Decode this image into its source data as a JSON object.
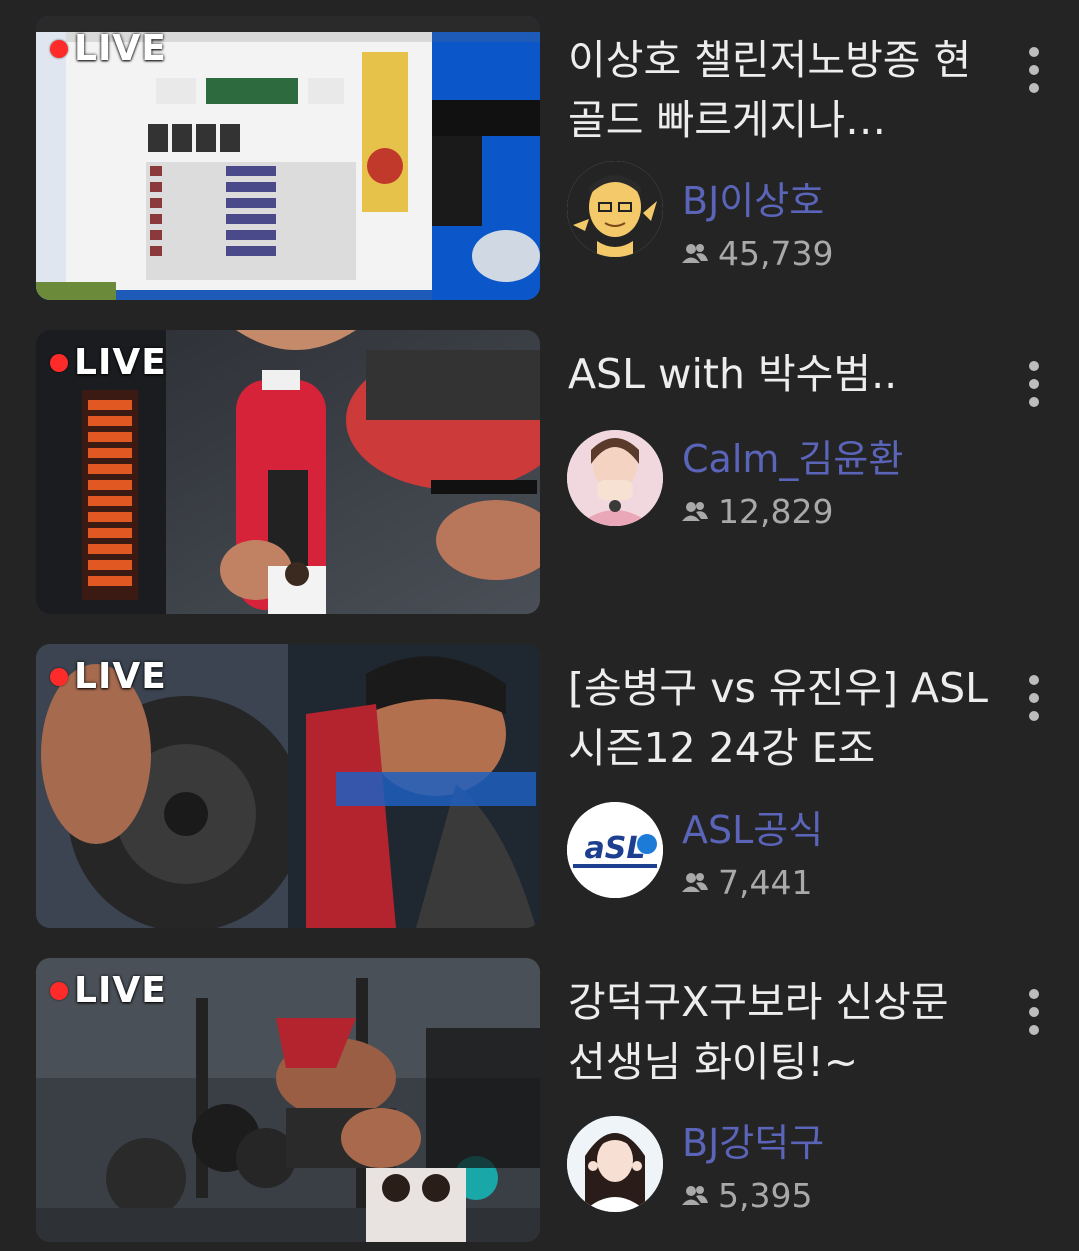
{
  "live_badge": "LIVE",
  "streams": [
    {
      "title": "이상호 챌린저노방종 현골드 빠르게지나…",
      "channel": "BJ이상호",
      "viewers": "45,739",
      "thumb_theme": "desktop-capture"
    },
    {
      "title": "ASL with 박수범..",
      "channel": "Calm_김윤환",
      "viewers": "12,829",
      "thumb_theme": "energy-drink-ad"
    },
    {
      "title": "[송병구 vs 유진우] ASL 시즌12 24강 E조",
      "channel": "ASL공식",
      "viewers": "7,441",
      "thumb_theme": "gym-ad"
    },
    {
      "title": "강덕구X구보라 신상문 선생님 화이팅!~",
      "channel": "BJ강덕구",
      "viewers": "5,395",
      "thumb_theme": "gym-shoe-ad"
    }
  ],
  "icons": {
    "more": "more-vertical-icon",
    "viewers": "viewers-icon",
    "live_dot": "live-dot-icon"
  },
  "colors": {
    "background": "#242424",
    "channel_text": "#5a64b8",
    "live_dot": "#ff2a2a"
  }
}
